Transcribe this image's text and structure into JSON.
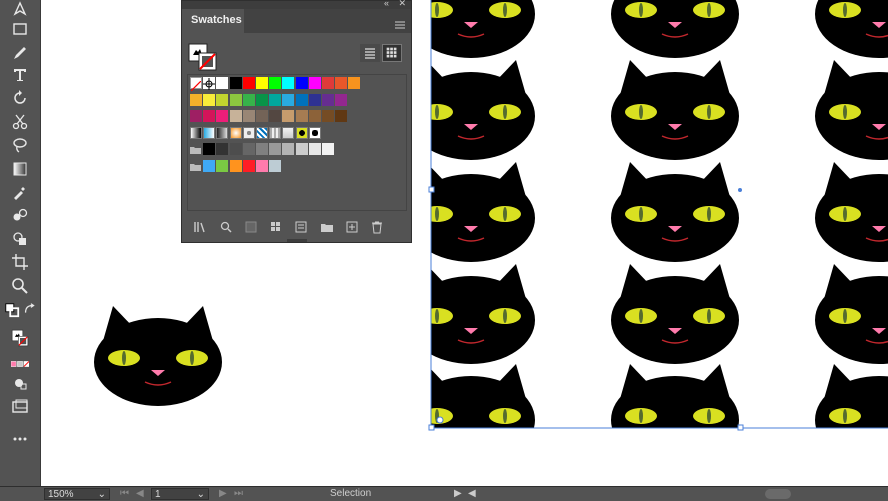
{
  "swatches_panel": {
    "title": "Swatches",
    "grid_rows": [
      [
        "none",
        "registration",
        "#ffffff",
        "#000000",
        "#ff0000",
        "#ffff00",
        "#00ff00",
        "#00ffff",
        "#0000ff",
        "#ff00ff",
        "#e03a3a",
        "#e8572a",
        "#f7931e"
      ],
      [
        "#f2b12a",
        "#f7ec3a",
        "#c2d52e",
        "#8cc63f",
        "#37b34a",
        "#089348",
        "#00a79d",
        "#29abe2",
        "#0072bc",
        "#2e3192",
        "#662d91",
        "#93278f"
      ],
      [
        "#9e1f63",
        "#d4145a",
        "#ed1e79",
        "#c7b299",
        "#998675",
        "#736357",
        "#534741",
        "#c69c6d",
        "#a67c52",
        "#8c6239",
        "#754c24",
        "#603813"
      ],
      [
        "pattern-grad",
        "pattern-sky",
        "pattern-grad2",
        "pattern-orange",
        "pattern-dots",
        "pattern-blue",
        "pattern-tile",
        "pattern-light",
        "pattern-cat",
        "pattern-cat2"
      ],
      [
        "folder",
        "#000000",
        "#333333",
        "#4d4d4d",
        "#666666",
        "#808080",
        "#999999",
        "#b3b3b3",
        "#cccccc",
        "#e6e6e6",
        "#f2f2f2"
      ],
      [
        "folder",
        "#3fa9f5",
        "#7ac943",
        "#ff931e",
        "#ff1d25",
        "#ff7bac",
        "#bdccd4"
      ]
    ]
  },
  "statusbar": {
    "zoom": "150%",
    "artboard": "1",
    "mode": "Selection"
  },
  "colors": {
    "cat": "#000000",
    "eye": "#d9e021",
    "pupil": "#556b2f",
    "nose": "#ff7bac",
    "mouth": "#c1272d",
    "selection": "#4a7fd8"
  }
}
